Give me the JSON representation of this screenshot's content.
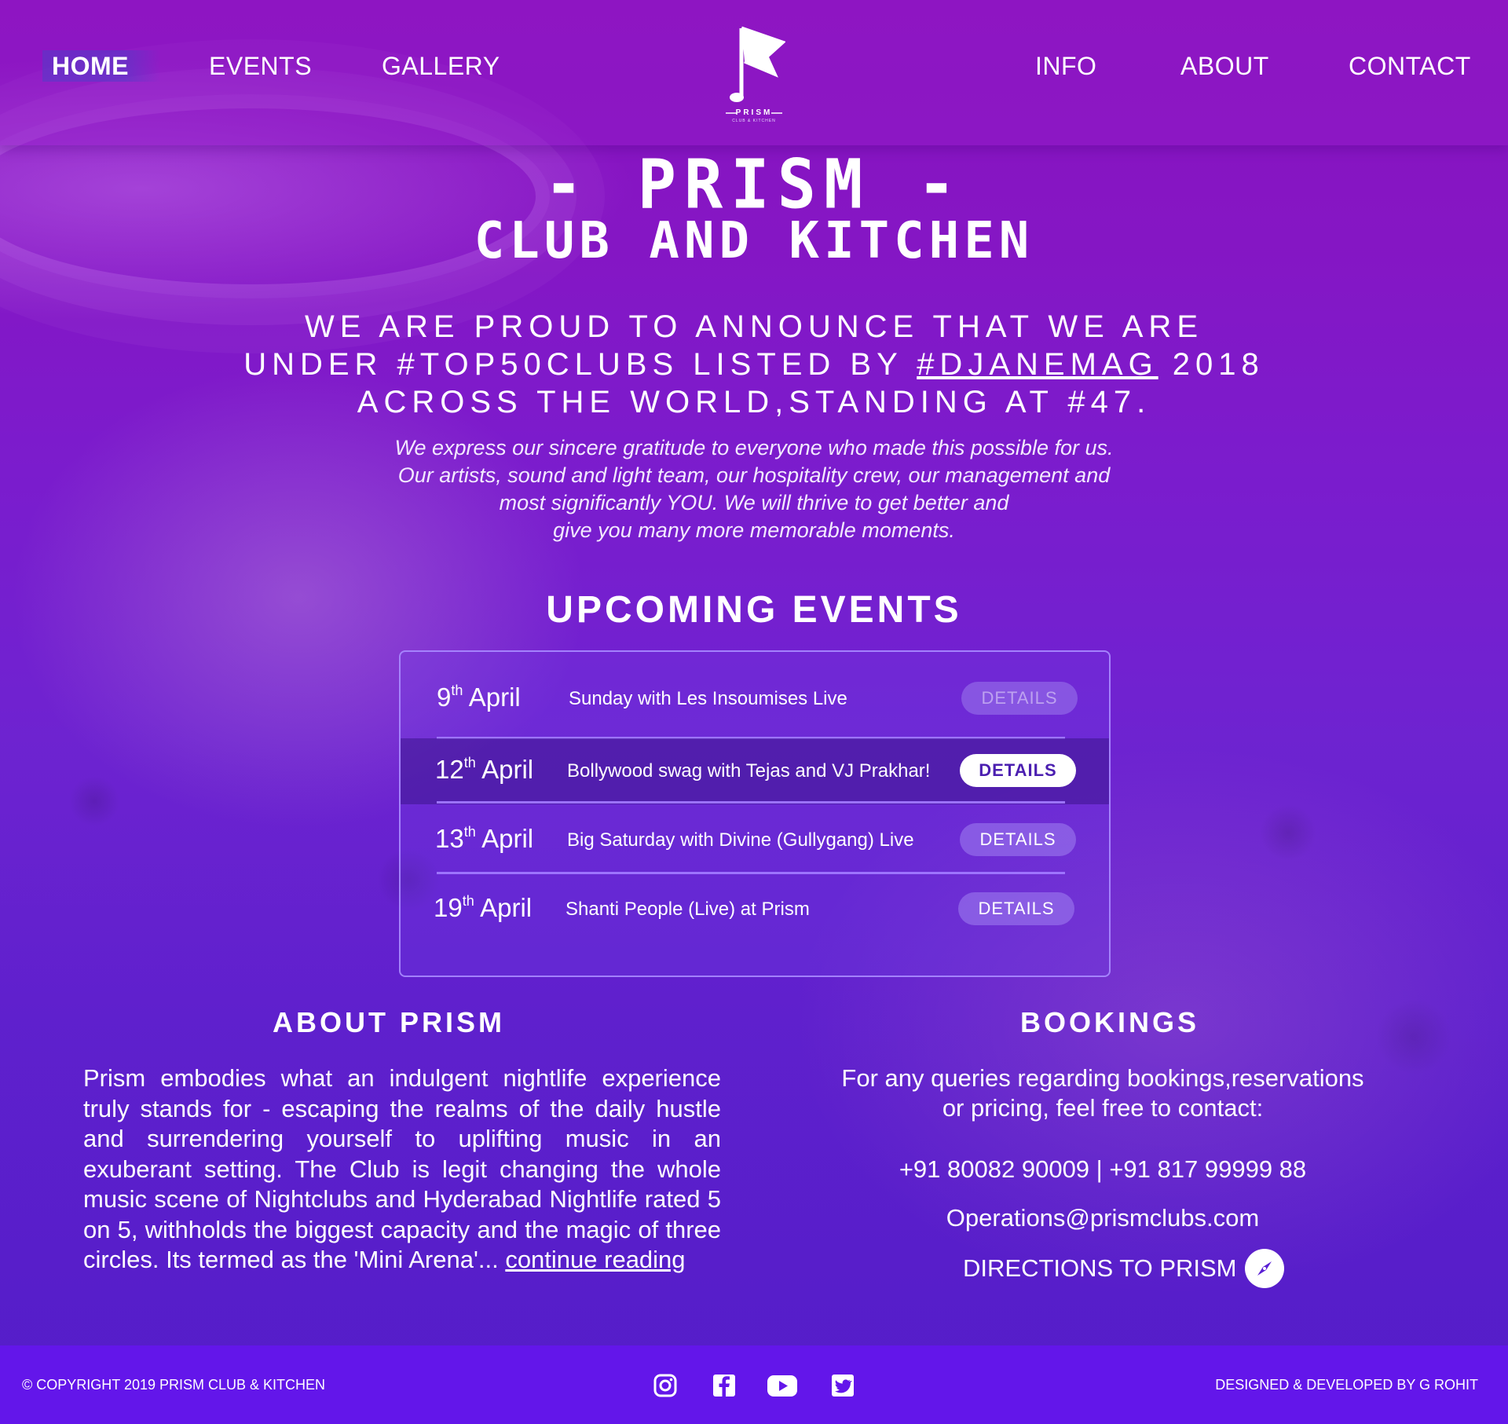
{
  "nav": {
    "left": [
      "HOME",
      "EVENTS",
      "GALLERY"
    ],
    "right": [
      "INFO",
      "ABOUT",
      "CONTACT"
    ],
    "active": "HOME"
  },
  "logo": {
    "name": "PRISM",
    "tagline": "CLUB & KITCHEN"
  },
  "hero": {
    "title": "- PRISM -",
    "subtitle": "CLUB AND KITCHEN",
    "announcement_part1": "WE ARE PROUD TO ANNOUNCE THAT WE ARE UNDER #TOP50CLUBS LISTED BY ",
    "announcement_link": "#DJANEMAG",
    "announcement_part2": " 2018 ACROSS THE WORLD,STANDING AT #47.",
    "gratitude_lines": [
      "We express our sincere gratitude to everyone who made this possible for us.",
      "Our artists, sound and light team, our hospitality crew, our management and",
      "most significantly YOU. We will thrive to get better and",
      "give you many more memorable moments."
    ]
  },
  "events": {
    "heading": "UPCOMING EVENTS",
    "items": [
      {
        "day": "9",
        "suffix": "th",
        "month": "April",
        "name": "Sunday with Les Insoumises Live",
        "button": "DETAILS"
      },
      {
        "day": "12",
        "suffix": "th",
        "month": "April",
        "name": "Bollywood swag with Tejas and VJ Prakhar!",
        "button": "DETAILS"
      },
      {
        "day": "13",
        "suffix": "th",
        "month": "April",
        "name": "Big Saturday with Divine (Gullygang) Live",
        "button": "DETAILS"
      },
      {
        "day": "19",
        "suffix": "th",
        "month": "April",
        "name": "Shanti People (Live) at Prism",
        "button": "DETAILS"
      }
    ]
  },
  "about": {
    "heading": "ABOUT PRISM",
    "text": "Prism embodies what an indulgent nightlife experience truly stands for - escaping the realms of the daily hustle and surrendering yourself to uplifting music in an exuberant setting. The Club is legit changing the whole music scene of Nightclubs and Hyderabad Nightlife rated 5 on 5, withholds the biggest capacity and the magic of three circles. Its termed as the 'Mini Arena'... ",
    "link": "continue reading"
  },
  "bookings": {
    "heading": "BOOKINGS",
    "line1": "For any queries regarding bookings,reservations",
    "line2": "or pricing, feel free to contact:",
    "phones": "+91 80082 90009 | +91 817 99999 88",
    "email": "Operations@prismclubs.com",
    "directions": "DIRECTIONS TO PRISM"
  },
  "footer": {
    "copyright": "© COPYRIGHT 2019 PRISM CLUB & KITCHEN",
    "designer": "DESIGNED & DEVELOPED BY G ROHIT",
    "social": [
      "instagram-icon",
      "facebook-icon",
      "youtube-icon",
      "twitter-icon"
    ]
  },
  "colors": {
    "background_top": "#8a12bf",
    "background_bottom": "#5a1fd4",
    "footer": "#6316ea",
    "accent_border": "#a08cff",
    "button_text_active": "#4b1fb0"
  }
}
